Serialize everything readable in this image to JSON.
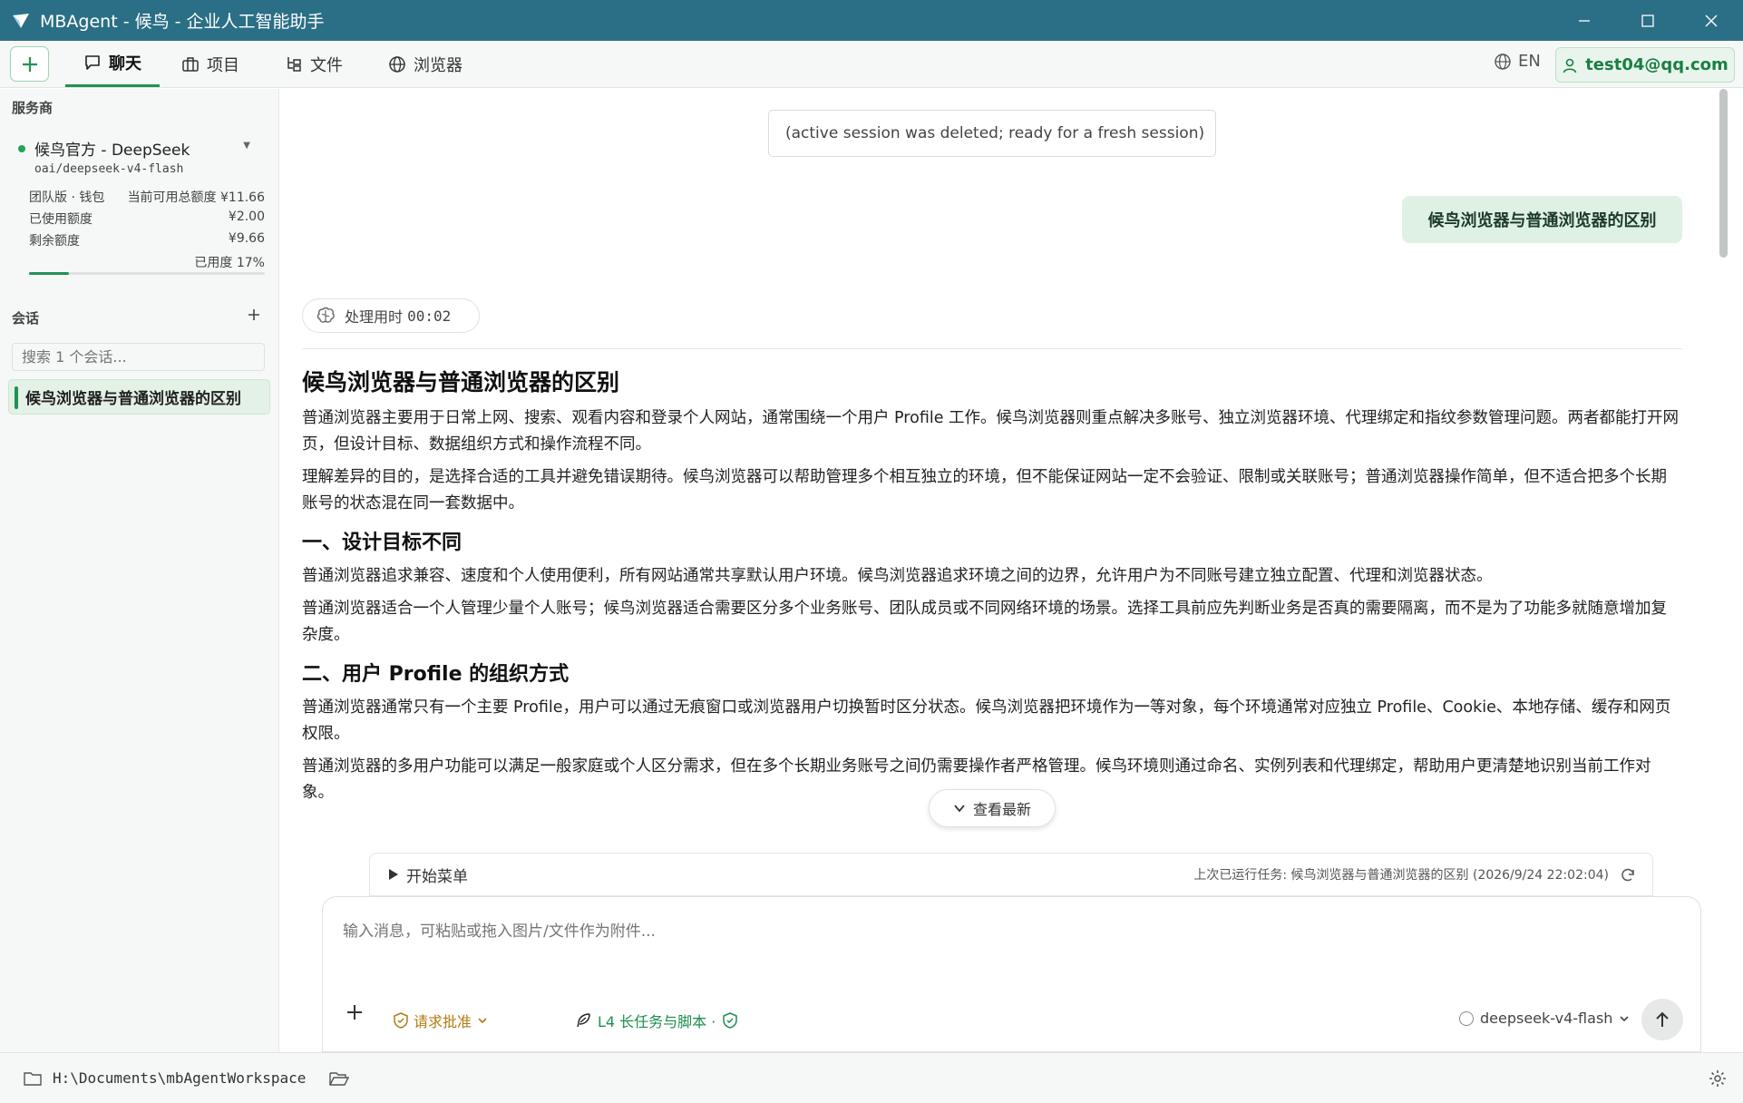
{
  "window": {
    "title": "MBAgent - 候鸟 - 企业人工智能助手"
  },
  "toolbar": {
    "tabs": [
      {
        "label": "聊天",
        "icon": "chat-icon",
        "active": true
      },
      {
        "label": "项目",
        "icon": "briefcase-icon",
        "active": false
      },
      {
        "label": "文件",
        "icon": "file-tree-icon",
        "active": false
      },
      {
        "label": "浏览器",
        "icon": "globe-icon",
        "active": false
      }
    ],
    "lang": "EN",
    "user": "test04@qq.com"
  },
  "sidebar": {
    "provider_heading": "服务商",
    "provider_name": "候鸟官方 - DeepSeek",
    "provider_model": "oai/deepseek-v4-flash",
    "wallet_label": "团队版 · 钱包",
    "available_label": "当前可用总额度 ¥11.66",
    "used_label": "已使用额度",
    "used_value": "¥2.00",
    "remaining_label": "剩余额度",
    "remaining_value": "¥9.66",
    "usage_text": "已用度 17%",
    "usage_fraction": 0.17,
    "sessions_heading": "会话",
    "search_placeholder": "搜索 1 个会话...",
    "sessions": [
      {
        "title": "候鸟浏览器与普通浏览器的区别",
        "active": true
      }
    ]
  },
  "chat": {
    "notice": "(active session was deleted; ready for a fresh session)",
    "user_message": "候鸟浏览器与普通浏览器的区别",
    "timer_label": "处理用时",
    "timer_value": "00:02",
    "answer": {
      "title": "候鸟浏览器与普通浏览器的区别",
      "intro_p1": "普通浏览器主要用于日常上网、搜索、观看内容和登录个人网站，通常围绕一个用户 Profile 工作。候鸟浏览器则重点解决多账号、独立浏览器环境、代理绑定和指纹参数管理问题。两者都能打开网页，但设计目标、数据组织方式和操作流程不同。",
      "intro_p2": "理解差异的目的，是选择合适的工具并避免错误期待。候鸟浏览器可以帮助管理多个相互独立的环境，但不能保证网站一定不会验证、限制或关联账号；普通浏览器操作简单，但不适合把多个长期账号的状态混在同一套数据中。",
      "s1_title": "一、设计目标不同",
      "s1_p1": "普通浏览器追求兼容、速度和个人使用便利，所有网站通常共享默认用户环境。候鸟浏览器追求环境之间的边界，允许用户为不同账号建立独立配置、代理和浏览器状态。",
      "s1_p2": "普通浏览器适合一个人管理少量个人账号；候鸟浏览器适合需要区分多个业务账号、团队成员或不同网络环境的场景。选择工具前应先判断业务是否真的需要隔离，而不是为了功能多就随意增加复杂度。",
      "s2_title": "二、用户 Profile 的组织方式",
      "s2_p1": "普通浏览器通常只有一个主要 Profile，用户可以通过无痕窗口或浏览器用户切换暂时区分状态。候鸟浏览器把环境作为一等对象，每个环境通常对应独立 Profile、Cookie、本地存储、缓存和网页权限。",
      "s2_p2": "普通浏览器的多用户功能可以满足一般家庭或个人区分需求，但在多个长期业务账号之间仍需要操作者严格管理。候鸟环境则通过命名、实例列表和代理绑定，帮助用户更清楚地识别当前工作对象。"
    },
    "see_latest": "查看最新",
    "start_menu": "开始菜单",
    "last_task": "上次已运行任务: 候鸟浏览器与普通浏览器的区别 (2026/9/24 22:02:04)",
    "input_placeholder": "输入消息，可粘贴或拖入图片/文件作为附件...",
    "approval": "请求批准",
    "level": "L4 长任务与脚本 ·",
    "model": "deepseek-v4-flash"
  },
  "statusbar": {
    "path": "H:\\Documents\\mbAgentWorkspace"
  },
  "colors": {
    "titlebar": "#2b6f86",
    "accent": "#1f9254",
    "approve": "#b07c0e"
  }
}
